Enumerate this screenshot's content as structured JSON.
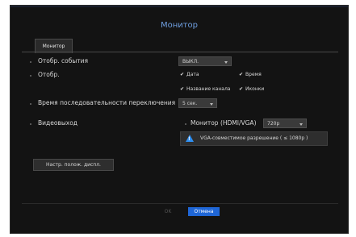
{
  "window": {
    "title": "Монитор"
  },
  "tabs": [
    {
      "label": "Монитор"
    }
  ],
  "settings": {
    "event_display": {
      "label": "Отобр. события",
      "value": "ВЫКЛ."
    },
    "display": {
      "label": "Отобр.",
      "options": [
        {
          "label": "Дата",
          "checked": true
        },
        {
          "label": "Время",
          "checked": true
        },
        {
          "label": "Название канала",
          "checked": true
        },
        {
          "label": "Иконки",
          "checked": true
        }
      ]
    },
    "sequence_time": {
      "label": "Время последовательности переключения",
      "value": "5 сек."
    },
    "video_out": {
      "label": "Видеовыход",
      "monitor_label": "Монитор (HDMI/VGA)",
      "monitor_value": "720p",
      "note": "VGA-совместимое разрешение ( ≤ 1080p )"
    },
    "display_position_button": "Настр. полож. диспл."
  },
  "footer": {
    "ok_label": "OK",
    "cancel_label": "Отмена"
  },
  "colors": {
    "background": "#131313",
    "title": "#6f9fe0",
    "accent": "#1f66d6",
    "warning": "#2f8ff0"
  },
  "icons": {
    "check": "checkmark-icon",
    "warning": "warning-triangle-icon",
    "dropdown": "chevron-down-icon"
  }
}
